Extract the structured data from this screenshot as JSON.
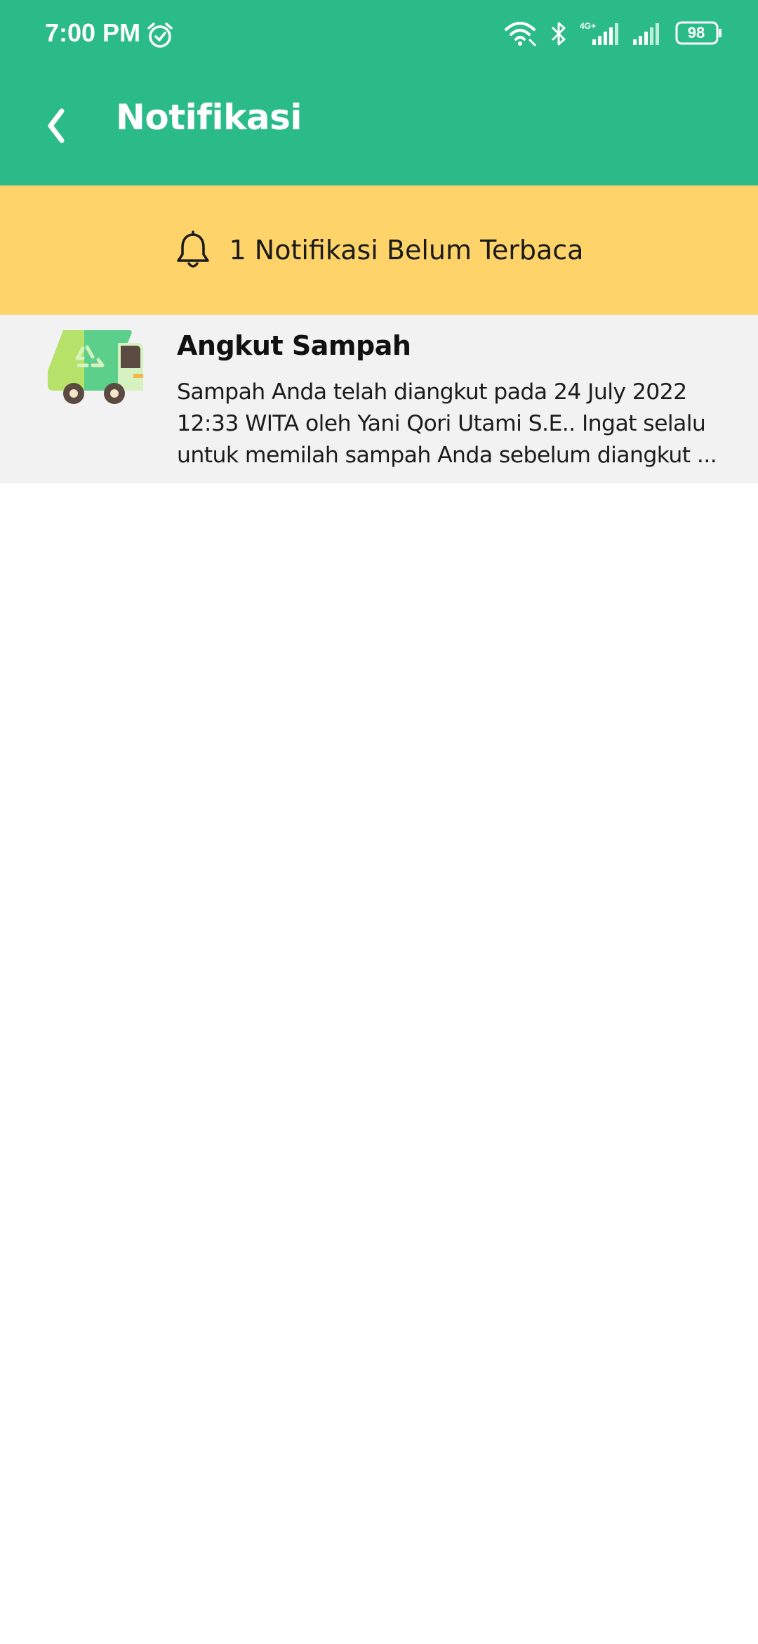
{
  "status_bar": {
    "time": "7:00 PM",
    "battery_level": "98",
    "network_type": "4G+",
    "icons": [
      "alarm-icon",
      "wifi-icon",
      "bluetooth-icon",
      "signal-icon",
      "signal-icon",
      "battery-icon"
    ]
  },
  "header": {
    "title": "Notifikasi",
    "back_icon": "chevron-left-icon",
    "background_color": "#2bbb89"
  },
  "unread_banner": {
    "text": "1 Notifikasi Belum Terbaca",
    "icon": "bell-icon",
    "background_color": "#fed46a"
  },
  "notifications": [
    {
      "icon": "garbage-truck-icon",
      "title": "Angkut Sampah",
      "message_lines": [
        "Sampah Anda telah diangkut pada 24 July 2022",
        "12:33 WITA oleh Yani Qori Utami S.E.. Ingat selalu",
        "untuk memilah sampah Anda sebelum diangkut ..."
      ],
      "background_color": "#f2f2f2"
    }
  ]
}
